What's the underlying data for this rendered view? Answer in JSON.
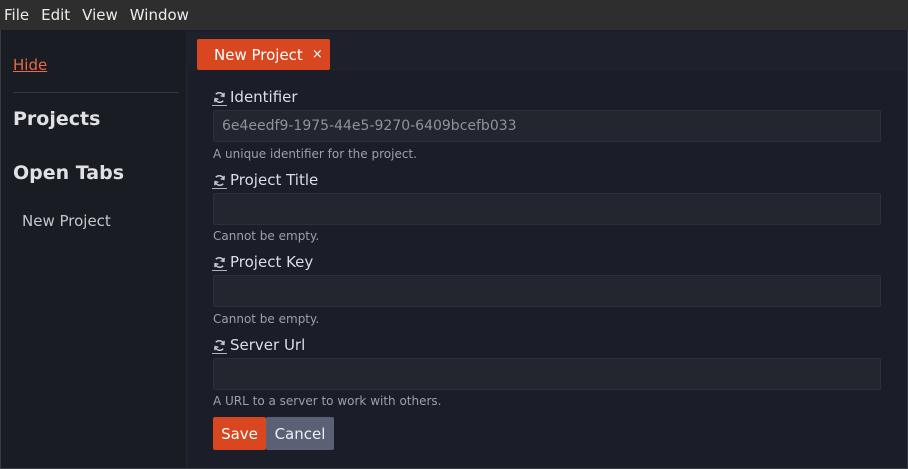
{
  "menubar": {
    "items": [
      "File",
      "Edit",
      "View",
      "Window"
    ]
  },
  "sidebar": {
    "hide_link": "Hide",
    "projects_heading": "Projects",
    "open_tabs_heading": "Open Tabs",
    "open_tabs": [
      "New Project"
    ]
  },
  "tabs": [
    {
      "label": "New Project",
      "close": "×",
      "active": true
    }
  ],
  "form": {
    "identifier": {
      "label": "Identifier",
      "value": "6e4eedf9-1975-44e5-9270-6409bcefb033",
      "help": "A unique identifier for the project."
    },
    "project_title": {
      "label": "Project Title",
      "value": "",
      "help": "Cannot be empty."
    },
    "project_key": {
      "label": "Project Key",
      "value": "",
      "help": "Cannot be empty."
    },
    "server_url": {
      "label": "Server Url",
      "value": "",
      "help": "A URL to a server to work with others."
    },
    "save_label": "Save",
    "cancel_label": "Cancel"
  },
  "colors": {
    "accent": "#d8471f",
    "link": "#e56a45",
    "secondary_button": "#5a6175"
  },
  "icons": {
    "field_icon": "refresh-icon",
    "tab_close": "close-icon"
  }
}
